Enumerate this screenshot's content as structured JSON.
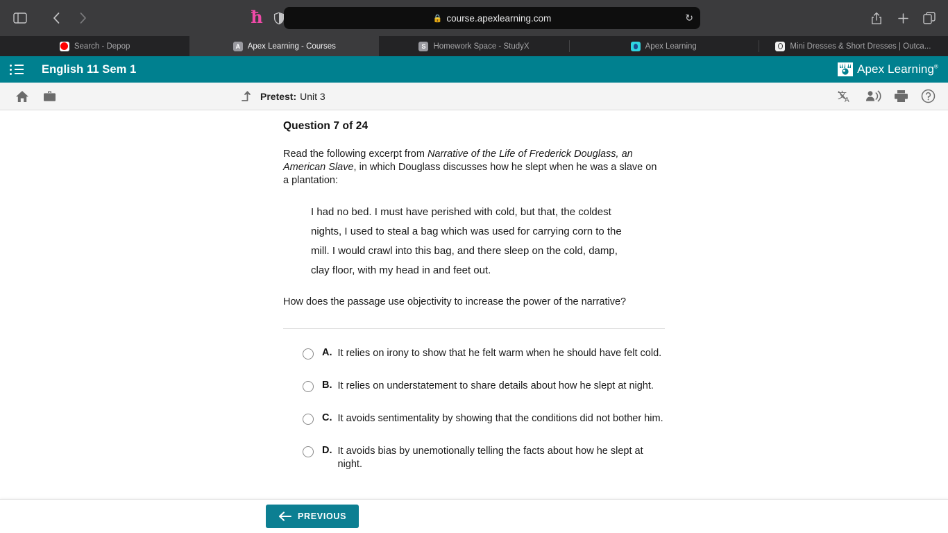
{
  "browser": {
    "url": "course.apexlearning.com",
    "lock_icon": "lock-icon",
    "reload_icon": "reload-icon",
    "sidebar_icon": "sidebar-toggle-icon",
    "back_icon": "back-arrow-icon",
    "forward_icon": "forward-arrow-icon",
    "honey_icon": "honey-extension-icon",
    "shield_icon": "shield-privacy-icon",
    "share_icon": "share-icon",
    "new_tab_icon": "plus-icon",
    "tabs_overview_icon": "tab-overview-icon",
    "tabs": [
      {
        "label": "Search - Depop",
        "favicon": "depop-favicon",
        "favicon_text": "",
        "active": false
      },
      {
        "label": "Apex Learning - Courses",
        "favicon": "apex-favicon",
        "favicon_text": "A",
        "active": true
      },
      {
        "label": "Homework Space - StudyX",
        "favicon": "studyx-favicon",
        "favicon_text": "S",
        "active": false
      },
      {
        "label": "Apex Learning",
        "favicon": "apex-logo-favicon",
        "favicon_text": "",
        "active": false
      },
      {
        "label": "Mini Dresses & Short Dresses | Outca...",
        "favicon": "outca-favicon",
        "favicon_text": "",
        "active": false
      }
    ]
  },
  "app_header": {
    "menu_icon": "course-outline-icon",
    "course_title": "English 11 Sem 1",
    "logo_text": "Apex Learning",
    "logo_trademark": "®",
    "logo_icon": "apex-learning-logo-icon",
    "background_color": "#00808f"
  },
  "sub_toolbar": {
    "home_icon": "home-icon",
    "briefcase_icon": "briefcase-icon",
    "back_to_parent_icon": "up-arrow-icon",
    "assignment_type": "Pretest:",
    "assignment_name": "Unit 3",
    "right_icons": [
      {
        "name": "translate-icon"
      },
      {
        "name": "read-aloud-icon"
      },
      {
        "name": "print-icon"
      },
      {
        "name": "help-icon"
      }
    ]
  },
  "question": {
    "heading": "Question 7 of 24",
    "intro_part1": "Read the following excerpt from ",
    "intro_italic": "Narrative of the Life of Frederick Douglass, an American Slave",
    "intro_part2": ", in which Douglass discusses how he slept when he was a slave on a plantation:",
    "excerpt": "I had no bed. I must have perished with cold, but that, the coldest nights, I used to steal a bag which was used for carrying corn to the mill. I would crawl into this bag, and there sleep on the cold, damp, clay floor, with my head in and feet out.",
    "prompt": "How does the passage use objectivity to increase the power of the narrative?",
    "answers": [
      {
        "letter": "A.",
        "text": "It relies on irony to show that he felt warm when he should have felt cold.",
        "selected": false
      },
      {
        "letter": "B.",
        "text": "It relies on understatement to share details about how he slept at night.",
        "selected": false
      },
      {
        "letter": "C.",
        "text": "It avoids sentimentality by showing that the conditions did not bother him.",
        "selected": false
      },
      {
        "letter": "D.",
        "text": "It avoids bias by unemotionally telling the facts about how he slept at night.",
        "selected": false
      }
    ]
  },
  "footer": {
    "previous_label": "PREVIOUS",
    "previous_icon": "arrow-left-icon",
    "button_color": "#0c7f92"
  }
}
